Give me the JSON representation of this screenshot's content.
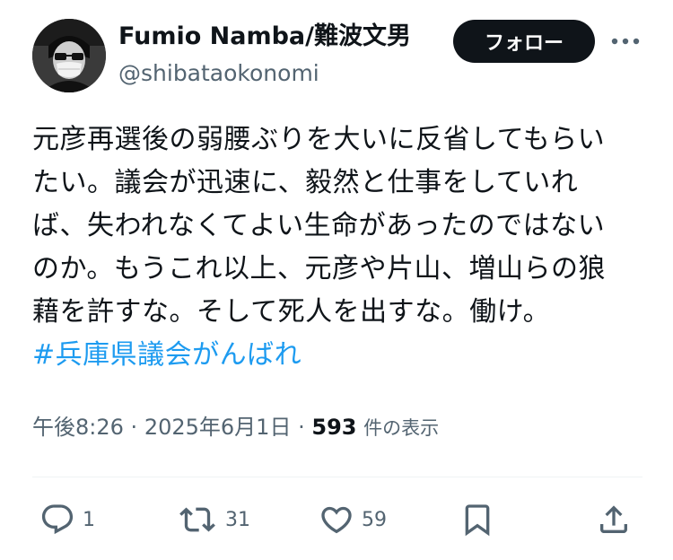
{
  "author": {
    "name": "Fumio Namba/難波文男",
    "handle": "@shibataokonomi"
  },
  "follow_label": "フォロー",
  "tweet": {
    "lines": [
      "元彦再選後の弱腰ぶりを大いに反省してもらい",
      "たい。議会が迅速に、毅然と仕事をしていれ",
      "ば、失われなくてよい生命があったのではない",
      "のか。もうこれ以上、元彦や片山、増山らの狼",
      "藉を許すな。そして死人を出すな。働け。"
    ],
    "hashtag": "#兵庫県議会がんばれ"
  },
  "meta": {
    "time": "午後8:26",
    "date": "2025年6月1日",
    "separator": "·",
    "views_count": "593",
    "views_label": "件の表示"
  },
  "actions": {
    "replies": "1",
    "retweets": "31",
    "likes": "59"
  },
  "icons": {
    "more": "more-horizontal-icon",
    "reply": "reply-icon",
    "retweet": "retweet-icon",
    "like": "heart-icon",
    "bookmark": "bookmark-icon",
    "share": "share-icon"
  },
  "colors": {
    "text": "#0f1419",
    "secondary": "#536471",
    "hashtag": "#1d9bf0",
    "button_bg": "#0f1419"
  }
}
